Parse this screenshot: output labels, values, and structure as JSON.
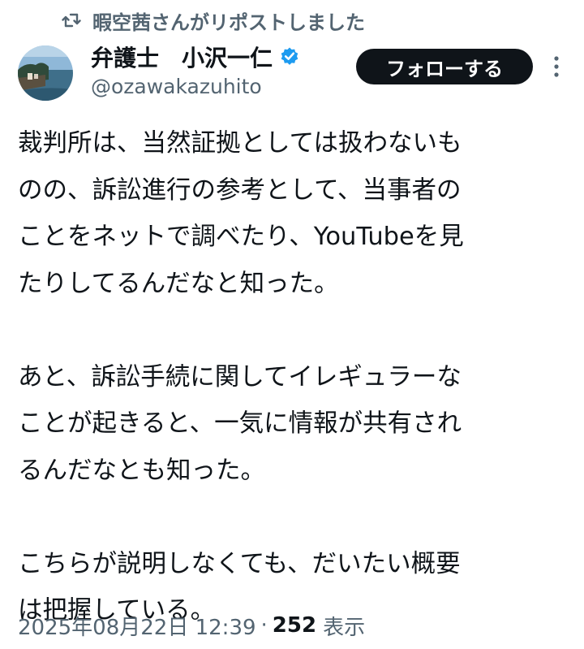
{
  "repost": {
    "text": "暇空茜さんがリポストしました",
    "icon": "repost-icon"
  },
  "author": {
    "name": "弁護士　小沢一仁",
    "handle": "@ozawakazuhito",
    "verified": true,
    "verified_color": "#1d9bf0"
  },
  "actions": {
    "follow_label": "フォローする",
    "more_icon": "more-options-icon"
  },
  "tweet": {
    "paragraphs": [
      "裁判所は、当然証拠としては扱わないも\nのの、訴訟進行の参考として、当事者の\nことをネットで調べたり、YouTubeを見\nたりしてるんだなと知った。",
      "あと、訴訟手続に関してイレギュラーな\nことが起きると、一気に情報が共有され\nるんだなとも知った。",
      "こちらが説明しなくても、だいたい概要\nは把握している。"
    ]
  },
  "meta": {
    "timestamp": "2025年08月22日 12:39",
    "separator": "·",
    "view_count": "252",
    "view_label": "表示"
  },
  "colors": {
    "text": "#0f1419",
    "secondary": "#536471",
    "follow_bg": "#0f1419"
  }
}
